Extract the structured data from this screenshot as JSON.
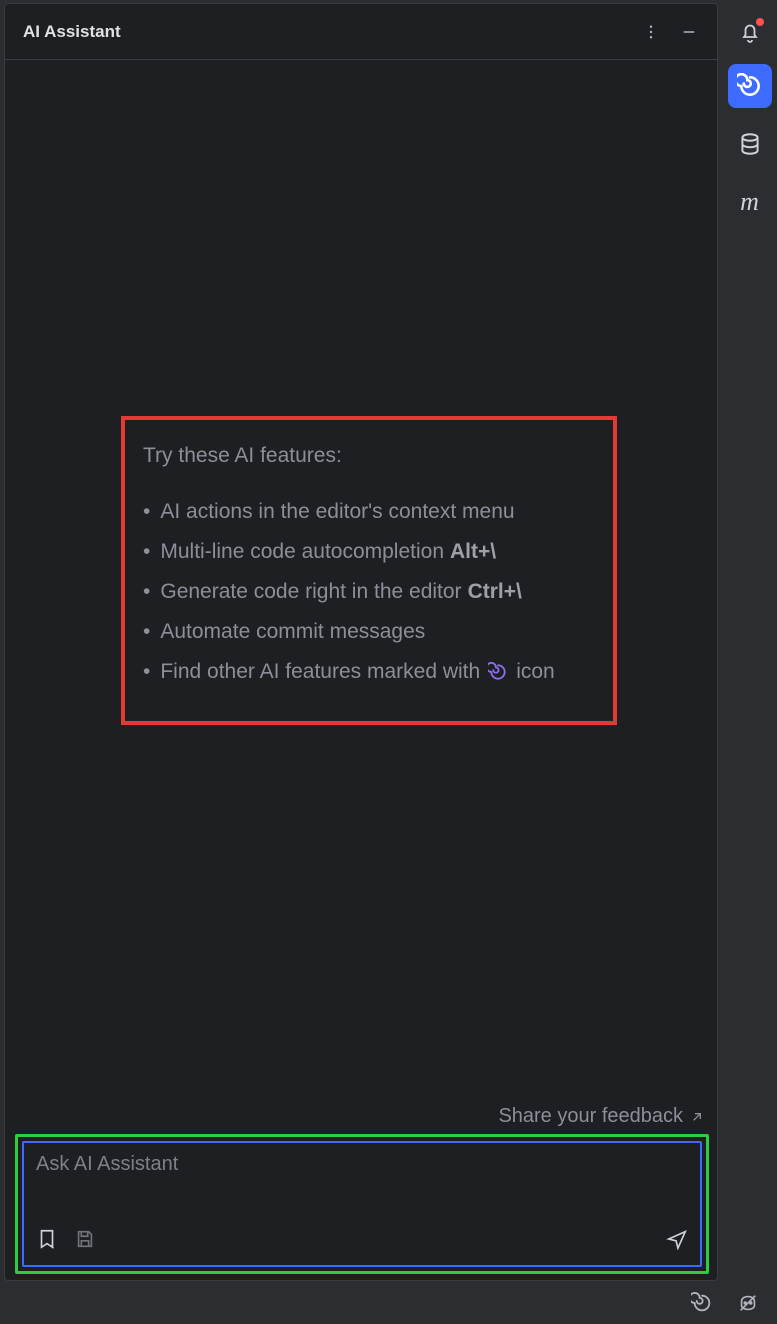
{
  "header": {
    "title": "AI Assistant"
  },
  "features": {
    "heading": "Try these AI features:",
    "items": [
      {
        "text": "AI actions in the editor's context menu",
        "shortcut": ""
      },
      {
        "text": "Multi-line code autocompletion",
        "shortcut": "Alt+\\"
      },
      {
        "text": "Generate code right in the editor",
        "shortcut": "Ctrl+\\"
      },
      {
        "text": "Automate commit messages",
        "shortcut": ""
      },
      {
        "text_prefix": "Find other AI features marked with",
        "text_suffix": "icon",
        "has_swirl": true
      }
    ]
  },
  "feedback": {
    "label": "Share your feedback"
  },
  "input": {
    "placeholder": "Ask AI Assistant"
  },
  "right_rail": {
    "notifications_icon": "bell-icon",
    "notifications_has_badge": true,
    "active_tool": "ai-assistant",
    "items": [
      {
        "name": "ai-assistant",
        "icon": "swirl-icon",
        "active": true
      },
      {
        "name": "database",
        "icon": "database-icon",
        "active": false
      },
      {
        "name": "maven",
        "icon": "m-icon",
        "active": false
      }
    ]
  },
  "statusbar": {
    "icons": [
      "swirl-icon",
      "copilot-off-icon"
    ]
  },
  "annotations": {
    "red_highlight": "features-box",
    "green_highlight": "input-area"
  }
}
